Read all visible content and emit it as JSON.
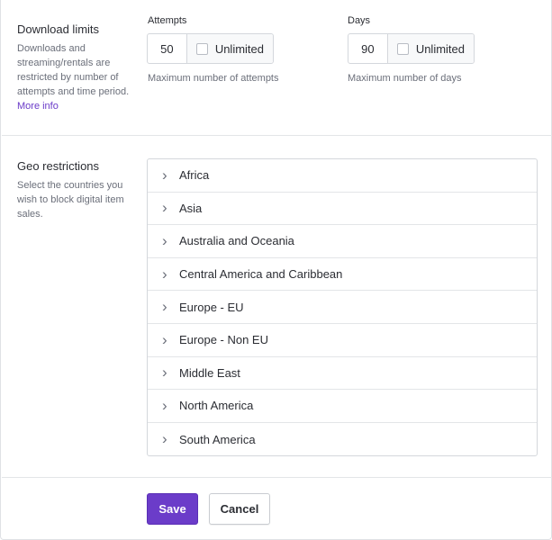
{
  "download_limits": {
    "title": "Download limits",
    "description": "Downloads and streaming/rentals are restricted by number of attempts and time period.",
    "more_info": "More info",
    "attempts": {
      "label": "Attempts",
      "value": "50",
      "unlimited_label": "Unlimited",
      "unlimited_checked": false,
      "hint": "Maximum number of attempts"
    },
    "days": {
      "label": "Days",
      "value": "90",
      "unlimited_label": "Unlimited",
      "unlimited_checked": false,
      "hint": "Maximum number of days"
    }
  },
  "geo_restrictions": {
    "title": "Geo restrictions",
    "description": "Select the countries you wish to block digital item sales.",
    "regions": [
      "Africa",
      "Asia",
      "Australia and Oceania",
      "Central America and Caribbean",
      "Europe - EU",
      "Europe - Non EU",
      "Middle East",
      "North America",
      "South America"
    ]
  },
  "actions": {
    "save_label": "Save",
    "cancel_label": "Cancel"
  },
  "colors": {
    "accent": "#6b3cc9"
  }
}
